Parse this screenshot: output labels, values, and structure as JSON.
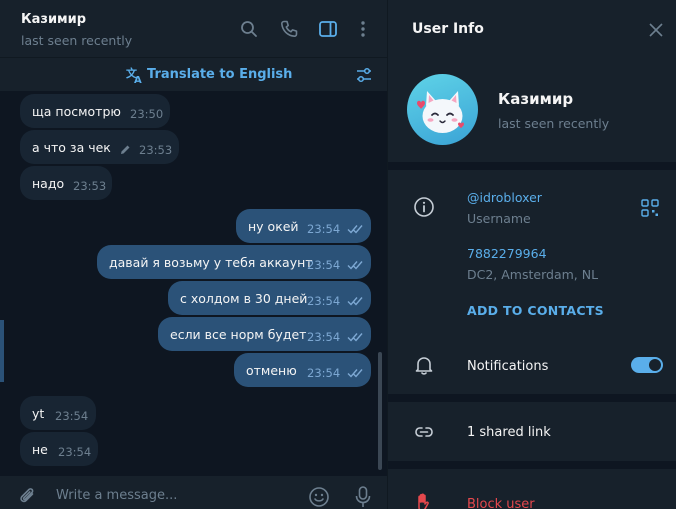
{
  "colors": {
    "accent": "#5aaeea",
    "outgoing_bubble": "#2b5278",
    "incoming_bubble": "#182533",
    "danger": "#e5484d",
    "panel_bg": "#17212b",
    "chat_bg": "#0e1621"
  },
  "chat": {
    "contact_name": "Казимир",
    "contact_status": "last seen recently",
    "header_icons": [
      "search-icon",
      "phone-icon",
      "sidebar-toggle-icon",
      "more-vertical-icon"
    ],
    "translate_label": "Translate to English",
    "messages": [
      {
        "dir": "in",
        "text": "ща посмотрю",
        "time": "23:50",
        "edited": false
      },
      {
        "dir": "in",
        "text": "а что за чек",
        "time": "23:53",
        "edited": true
      },
      {
        "dir": "in",
        "text": "надо",
        "time": "23:53",
        "edited": false
      },
      {
        "dir": "out",
        "text": "ну окей",
        "time": "23:54",
        "read": true
      },
      {
        "dir": "out",
        "text": "давай я возьму у тебя аккаунт",
        "time": "23:54",
        "read": true
      },
      {
        "dir": "out",
        "text": "с холдом в 30 дней",
        "time": "23:54",
        "read": true
      },
      {
        "dir": "out",
        "text": "если все норм будет",
        "time": "23:54",
        "read": true
      },
      {
        "dir": "out",
        "text": "отменю",
        "time": "23:54",
        "read": true
      },
      {
        "dir": "in",
        "text": "yt",
        "time": "23:54",
        "edited": false
      },
      {
        "dir": "in",
        "text": "не",
        "time": "23:54",
        "edited": false
      }
    ],
    "composer_placeholder": "Write a message..."
  },
  "info": {
    "title": "User Info",
    "name": "Казимир",
    "status": "last seen recently",
    "username": "@idrobloxer",
    "username_label": "Username",
    "phone": "7882279964",
    "phone_label": "DC2, Amsterdam, NL",
    "add_contact": "ADD TO CONTACTS",
    "notifications_label": "Notifications",
    "notifications_on": true,
    "shared_links": "1 shared link",
    "block_label": "Block user"
  }
}
